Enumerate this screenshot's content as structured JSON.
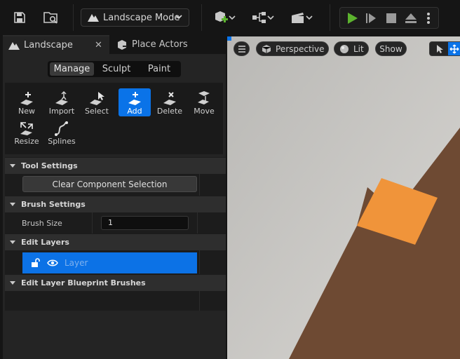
{
  "toolbar": {
    "mode_label": "Landscape Mode",
    "icons": [
      "save-icon",
      "content-browser-icon",
      "landscape-mode-icon",
      "add-actor-icon",
      "blueprint-icon",
      "cinematics-icon",
      "play-icon",
      "advance-frame-icon",
      "stop-icon",
      "eject-icon",
      "more-options-icon"
    ]
  },
  "tabs": {
    "landscape": "Landscape",
    "place_actors": "Place Actors",
    "close_glyph": "✕"
  },
  "mode_tabs": [
    "Manage",
    "Sculpt",
    "Paint"
  ],
  "tools": [
    {
      "label": "New",
      "icon": "new-icon"
    },
    {
      "label": "Import",
      "icon": "import-icon"
    },
    {
      "label": "Select",
      "icon": "select-icon"
    },
    {
      "label": "Add",
      "icon": "add-icon"
    },
    {
      "label": "Delete",
      "icon": "delete-icon"
    },
    {
      "label": "Move",
      "icon": "move-icon"
    },
    {
      "label": "Resize",
      "icon": "resize-icon"
    },
    {
      "label": "Splines",
      "icon": "splines-icon"
    }
  ],
  "sections": {
    "tool_settings": "Tool Settings",
    "clear_selection": "Clear Component Selection",
    "brush_settings": "Brush Settings",
    "brush_size_label": "Brush Size",
    "brush_size_value": "1",
    "edit_layers": "Edit Layers",
    "layer_name": "Layer",
    "edit_layer_blueprint": "Edit Layer Blueprint Brushes"
  },
  "viewport": {
    "perspective": "Perspective",
    "lit": "Lit",
    "show": "Show"
  },
  "colors": {
    "accent": "#0a73e8",
    "play_green": "#5cb32e",
    "terrain_brown": "#6e4a33",
    "highlight_orange": "#f0943a",
    "viewport_bg": "#c8c6c2"
  }
}
